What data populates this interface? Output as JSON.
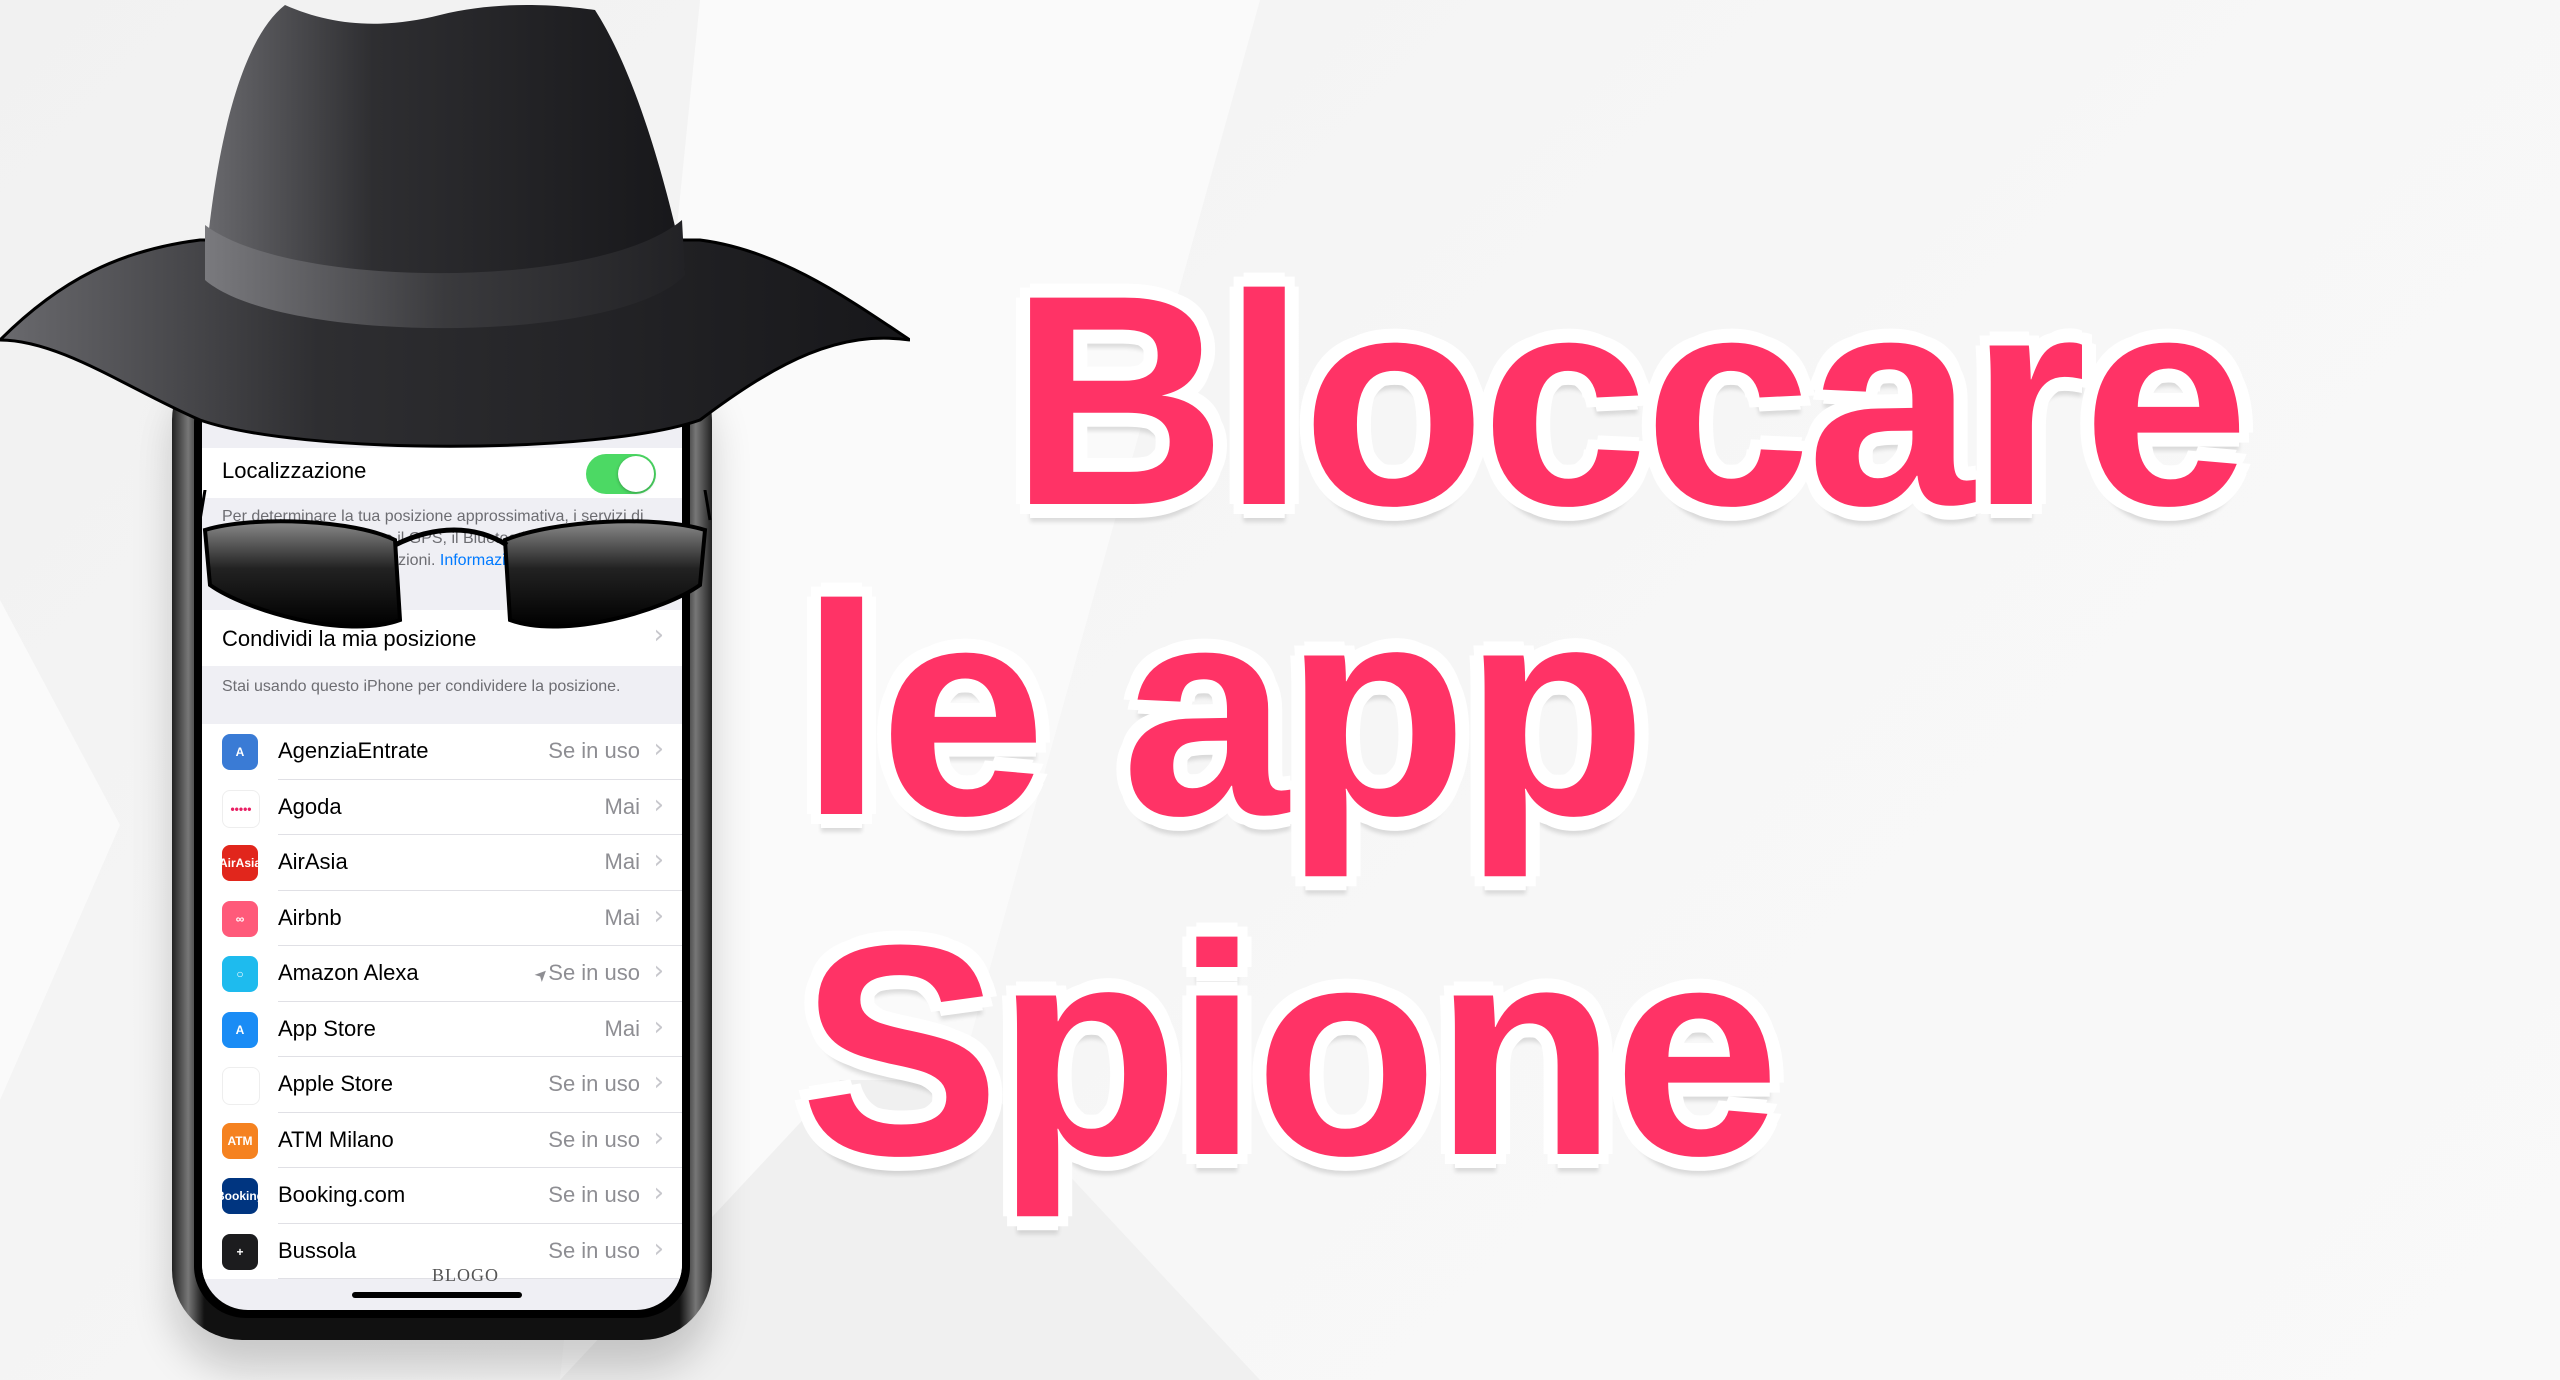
{
  "headline": {
    "line1": "Bloccare",
    "line2": "le app Spione",
    "color": "#ff3366"
  },
  "phone": {
    "location_services_label": "Localizzazione",
    "location_toggle_on": true,
    "description": "Per determinare la tua posizione approssimativa, i servizi di localizzazione utilizzano il GPS, il Bluetooth e le reti Wi-Fi crowd-sourced sulle posizioni.",
    "description_link": "Informazioni...",
    "share_location_label": "Condividi la mia posizione",
    "share_location_note": "Stai usando questo iPhone per condividere la posizione.",
    "apps": [
      {
        "name": "AgenziaEntrate",
        "status": "Se in uso",
        "icon": "agenzia-entrate-icon",
        "color": "#3a7bd5",
        "glyph": "A",
        "location_arrow": false
      },
      {
        "name": "Agoda",
        "status": "Mai",
        "icon": "agoda-icon",
        "color": "#ffffff",
        "glyph": "•••••",
        "location_arrow": false
      },
      {
        "name": "AirAsia",
        "status": "Mai",
        "icon": "airasia-icon",
        "color": "#e1261c",
        "glyph": "AirAsia",
        "location_arrow": false
      },
      {
        "name": "Airbnb",
        "status": "Mai",
        "icon": "airbnb-icon",
        "color": "#ff5a7a",
        "glyph": "∞",
        "location_arrow": false
      },
      {
        "name": "Amazon Alexa",
        "status": "Se in uso",
        "icon": "amazon-alexa-icon",
        "color": "#1ebbee",
        "glyph": "○",
        "location_arrow": true
      },
      {
        "name": "App Store",
        "status": "Mai",
        "icon": "app-store-icon",
        "color": "#1a8cf5",
        "glyph": "A",
        "location_arrow": false
      },
      {
        "name": "Apple Store",
        "status": "Se in uso",
        "icon": "apple-store-icon",
        "color": "#ffffff",
        "glyph": "",
        "location_arrow": false
      },
      {
        "name": "ATM Milano",
        "status": "Se in uso",
        "icon": "atm-milano-icon",
        "color": "#f58220",
        "glyph": "ATM",
        "location_arrow": false
      },
      {
        "name": "Booking.com",
        "status": "Se in uso",
        "icon": "booking-icon",
        "color": "#003580",
        "glyph": "Booking",
        "location_arrow": false
      },
      {
        "name": "Bussola",
        "status": "Se in uso",
        "icon": "compass-icon",
        "color": "#1c1c1e",
        "glyph": "+",
        "location_arrow": false
      }
    ],
    "watermark": "BLOGO"
  }
}
